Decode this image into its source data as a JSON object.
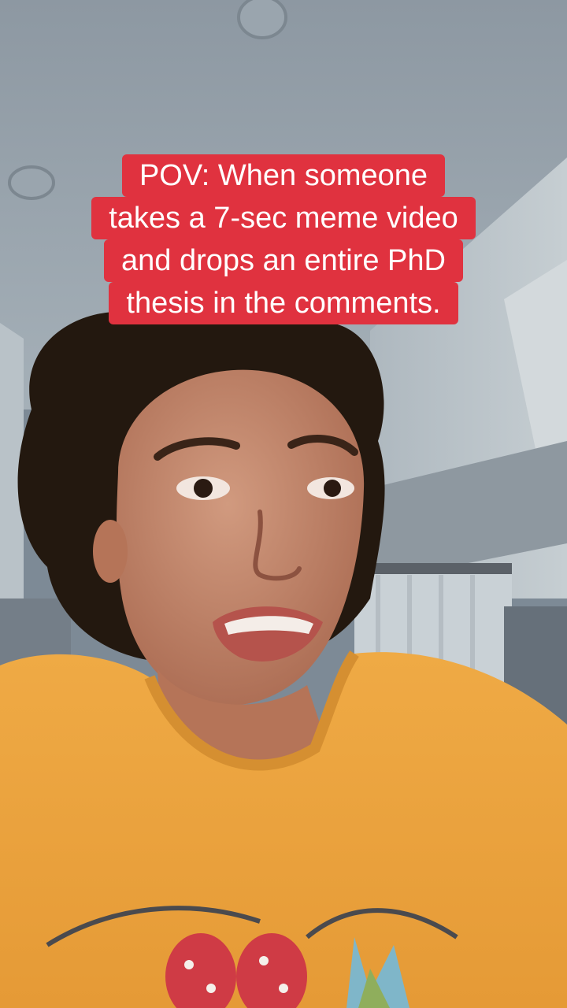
{
  "caption": {
    "lines": [
      "POV: When someone",
      "takes a 7-sec meme video",
      "and drops an entire PhD",
      "thesis in the comments."
    ],
    "background_color": "#e0323f",
    "text_color": "#ffffff"
  },
  "video": {
    "subject": "person-in-yellow-tshirt",
    "shirt_color": "#efa33c"
  }
}
